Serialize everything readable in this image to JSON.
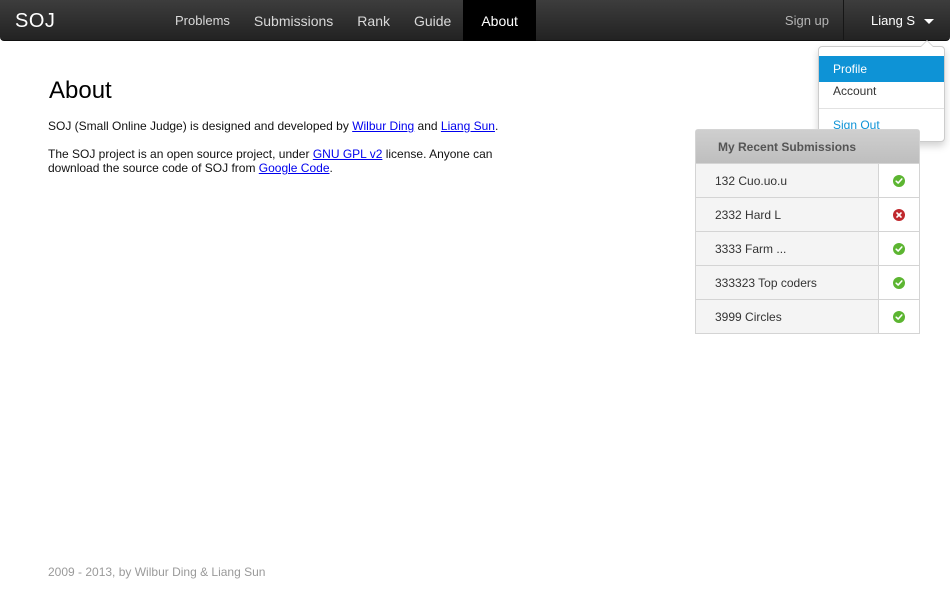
{
  "navbar": {
    "brand": "SOJ",
    "items": [
      {
        "label": "Problems",
        "active": false
      },
      {
        "label": "Submissions",
        "active": false
      },
      {
        "label": "Rank",
        "active": false
      },
      {
        "label": "Guide",
        "active": false
      },
      {
        "label": "About",
        "active": true
      }
    ],
    "signup_label": "Sign up",
    "user_label": "Liang S"
  },
  "user_menu": {
    "items": [
      "Profile",
      "Account"
    ],
    "signout_label": "Sign Out",
    "highlight_color": "#0e93d6"
  },
  "main": {
    "title": "About",
    "p1": {
      "before": "SOJ (Small Online Judge) is designed and developed by ",
      "link1": "Wilbur Ding",
      "mid": " and ",
      "link2": "Liang Sun",
      "after": "."
    },
    "p2": {
      "before": "The SOJ project is an open source project, under ",
      "link1": "GNU GPL v2",
      "mid": " license. Anyone can download the source code of SOJ from ",
      "link2": "Google Code",
      "after": "."
    }
  },
  "recent_submissions": {
    "title": "My Recent Submissions",
    "rows": [
      {
        "label": "132 Cuo.uo.u",
        "status": "accepted"
      },
      {
        "label": "2332 Hard L",
        "status": "rejected"
      },
      {
        "label": "3333 Farm ...",
        "status": "accepted"
      },
      {
        "label": "333323 Top coders",
        "status": "accepted"
      },
      {
        "label": "3999 Circles",
        "status": "accepted"
      }
    ],
    "colors": {
      "accepted": "#5cb531",
      "rejected": "#c0282d"
    }
  },
  "footer": {
    "text": "2009 - 2013, by Wilbur Ding & Liang Sun"
  }
}
